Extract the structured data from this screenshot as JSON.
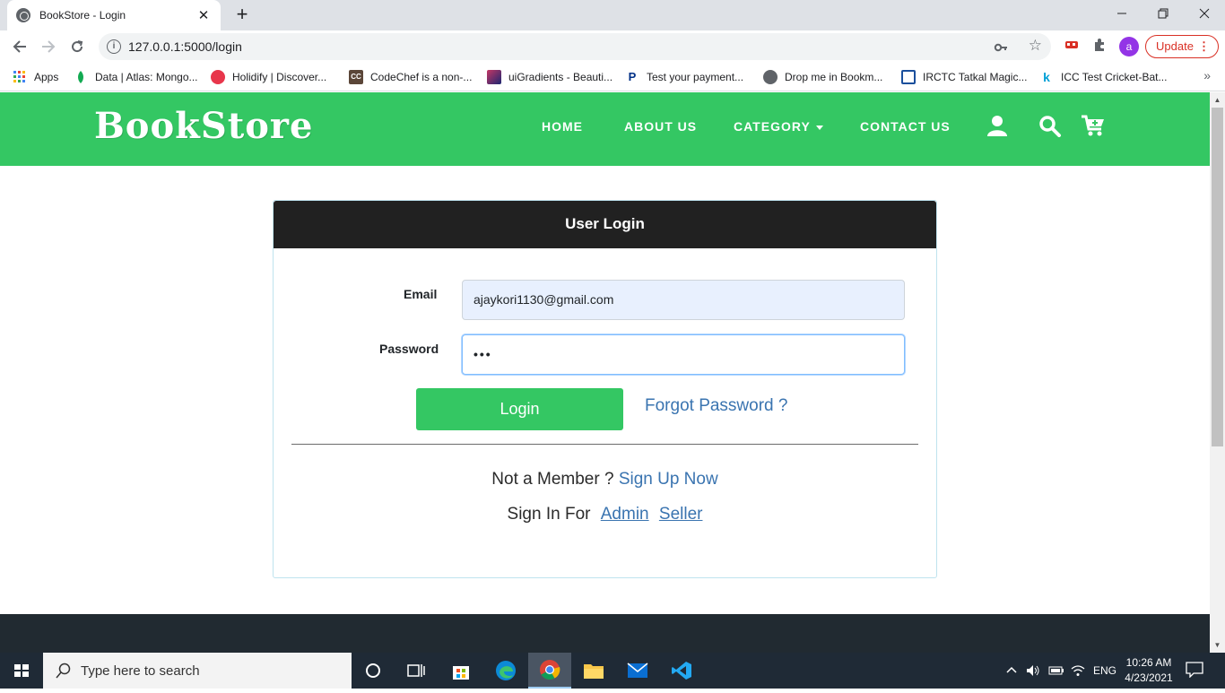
{
  "browser": {
    "tab_title": "BookStore - Login",
    "tab_close": "✕",
    "new_tab": "+",
    "url": "127.0.0.1:5000/login",
    "update_label": "Update",
    "profile_initial": "a",
    "bookmarks": [
      {
        "label": "Apps",
        "icon": "apps-grid-icon",
        "color": "#4285f4"
      },
      {
        "label": "Data | Atlas: Mongo...",
        "icon": "mongodb-leaf-icon",
        "color": "#13aa52"
      },
      {
        "label": "Holidify | Discover...",
        "icon": "holidify-icon",
        "color": "#e8364b"
      },
      {
        "label": "CodeChef is a non-...",
        "icon": "codechef-icon",
        "color": "#5b4638"
      },
      {
        "label": "uiGradients - Beauti...",
        "icon": "uigradients-icon",
        "color": "#c33764"
      },
      {
        "label": "Test your payment...",
        "icon": "paypal-icon",
        "color": "#003087"
      },
      {
        "label": "Drop me in Bookm...",
        "icon": "globe-icon",
        "color": "#5f6368"
      },
      {
        "label": "IRCTC Tatkal Magic...",
        "icon": "irctc-icon",
        "color": "#1a4f9c"
      },
      {
        "label": "ICC Test Cricket-Bat...",
        "icon": "k-icon",
        "color": "#00a0d6"
      }
    ]
  },
  "site": {
    "brand": "BookStore",
    "nav": {
      "home": "HOME",
      "about": "ABOUT US",
      "category": "CATEGORY",
      "contact": "CONTACT US"
    },
    "colors": {
      "primary": "#34c763",
      "dark": "#212121",
      "link": "#3a74b0"
    }
  },
  "login": {
    "heading": "User Login",
    "email_label": "Email",
    "email_value": "ajaykori1130@gmail.com",
    "password_label": "Password",
    "password_value": "•••",
    "login_button": "Login",
    "forgot_link": "Forgot Password ?",
    "member_text": "Not a Member ?",
    "signup_link": "Sign Up Now",
    "signin_text": "Sign In For",
    "admin_link": "Admin",
    "seller_link": "Seller"
  },
  "taskbar": {
    "search_placeholder": "Type here to search",
    "language": "ENG",
    "time": "10:26 AM",
    "date": "4/23/2021"
  }
}
